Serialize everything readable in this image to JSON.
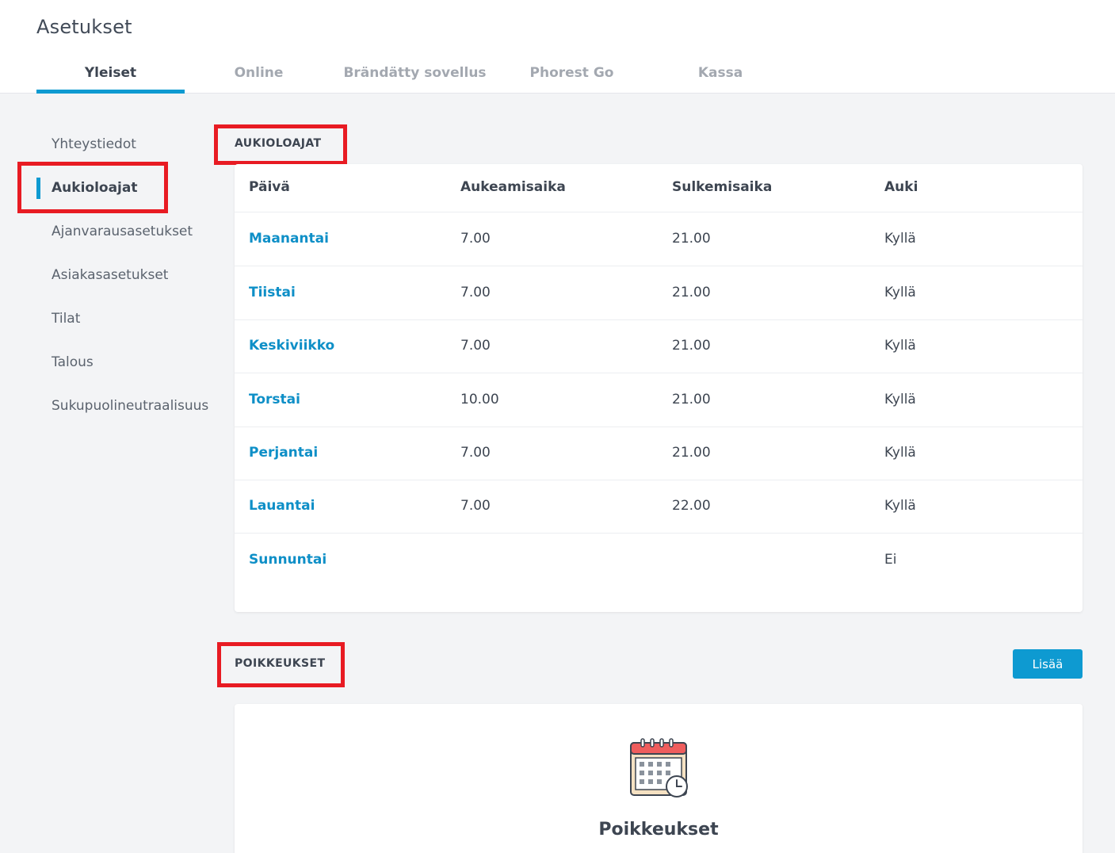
{
  "header": {
    "title": "Asetukset"
  },
  "tabs": [
    {
      "label": "Yleiset",
      "active": true
    },
    {
      "label": "Online",
      "active": false
    },
    {
      "label": "Brändätty sovellus",
      "active": false
    },
    {
      "label": "Phorest Go",
      "active": false
    },
    {
      "label": "Kassa",
      "active": false
    }
  ],
  "sidebar": {
    "items": [
      {
        "label": "Yhteystiedot",
        "active": false
      },
      {
        "label": "Aukioloajat",
        "active": true
      },
      {
        "label": "Ajanvarausasetukset",
        "active": false
      },
      {
        "label": "Asiakasasetukset",
        "active": false
      },
      {
        "label": "Tilat",
        "active": false
      },
      {
        "label": "Talous",
        "active": false
      },
      {
        "label": "Sukupuolineutraalisuus",
        "active": false
      }
    ]
  },
  "opening_hours": {
    "section_label": "AUKIOLOAJAT",
    "columns": [
      "Päivä",
      "Aukeamisaika",
      "Sulkemisaika",
      "Auki"
    ],
    "rows": [
      {
        "day": "Maanantai",
        "open": "7.00",
        "close": "21.00",
        "is_open": "Kyllä"
      },
      {
        "day": "Tiistai",
        "open": "7.00",
        "close": "21.00",
        "is_open": "Kyllä"
      },
      {
        "day": "Keskiviikko",
        "open": "7.00",
        "close": "21.00",
        "is_open": "Kyllä"
      },
      {
        "day": "Torstai",
        "open": "10.00",
        "close": "21.00",
        "is_open": "Kyllä"
      },
      {
        "day": "Perjantai",
        "open": "7.00",
        "close": "21.00",
        "is_open": "Kyllä"
      },
      {
        "day": "Lauantai",
        "open": "7.00",
        "close": "22.00",
        "is_open": "Kyllä"
      },
      {
        "day": "Sunnuntai",
        "open": "",
        "close": "",
        "is_open": "Ei"
      }
    ]
  },
  "exceptions": {
    "section_label": "POIKKEUKSET",
    "add_button": "Lisää",
    "empty_title": "Poikkeukset",
    "icon": "calendar-clock-icon"
  },
  "colors": {
    "accent": "#0e9ad1",
    "highlight": "#e81b23",
    "link": "#0e8fc7"
  }
}
